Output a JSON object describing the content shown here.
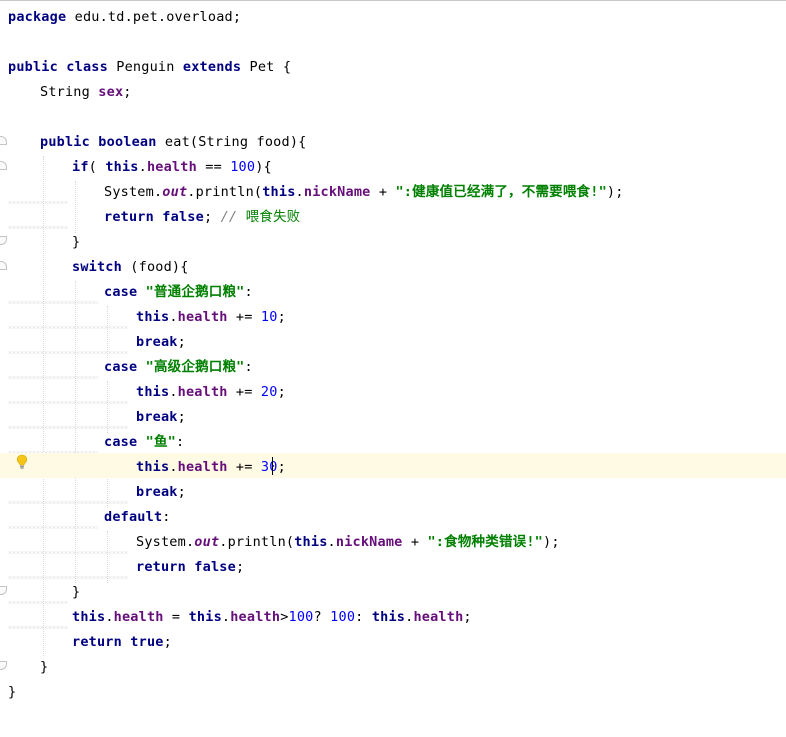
{
  "editor": {
    "language": "java",
    "theme_colors": {
      "keyword": "#000080",
      "field": "#660e7a",
      "number": "#0000ff",
      "string": "#008000",
      "comment": "#808080",
      "caret_line": "#fffae3"
    },
    "lines": {
      "l1": {
        "kw1": "package",
        "t1": " edu.td.pet.overload;"
      },
      "l3": {
        "kw1": "public",
        "s1": " ",
        "kw2": "class",
        "t1": " Penguin ",
        "kw3": "extends",
        "t2": " Pet {"
      },
      "l4": {
        "t1": "String ",
        "f1": "sex",
        "t2": ";"
      },
      "l6": {
        "kw1": "public",
        "s1": " ",
        "kw2": "boolean",
        "t1": " eat(String food){"
      },
      "l7": {
        "kw1": "if",
        "t1": "( ",
        "kw2": "this",
        "t2": ".",
        "f1": "health",
        "t3": " == ",
        "n1": "100",
        "t4": "){"
      },
      "l8": {
        "t1": "System.",
        "sf1": "out",
        "t2": ".println(",
        "kw1": "this",
        "t3": ".",
        "f1": "nickName",
        "t4": " + ",
        "str1": "\":健康值已经满了，不需要喂食!\"",
        "t5": ");"
      },
      "l9": {
        "kw1": "return",
        "s1": " ",
        "kw2": "false",
        "t1": "; ",
        "c1": "// ",
        "c2": "喂食失败"
      },
      "l10": {
        "t1": "}"
      },
      "l11": {
        "kw1": "switch",
        "t1": " (food){"
      },
      "l12": {
        "kw1": "case",
        "s1": " ",
        "str1": "\"普通企鹅口粮\"",
        "t1": ":"
      },
      "l13": {
        "kw1": "this",
        "t1": ".",
        "f1": "health",
        "t2": " += ",
        "n1": "10",
        "t3": ";"
      },
      "l14": {
        "kw1": "break",
        "t1": ";"
      },
      "l15": {
        "kw1": "case",
        "s1": " ",
        "str1": "\"高级企鹅口粮\"",
        "t1": ":"
      },
      "l16": {
        "kw1": "this",
        "t1": ".",
        "f1": "health",
        "t2": " += ",
        "n1": "20",
        "t3": ";"
      },
      "l17": {
        "kw1": "break",
        "t1": ";"
      },
      "l18": {
        "kw1": "case",
        "s1": " ",
        "str1": "\"鱼\"",
        "t1": ":"
      },
      "l19": {
        "kw1": "this",
        "t1": ".",
        "f1": "health",
        "t2": " += ",
        "n1": "30",
        "t3": ";"
      },
      "l20": {
        "kw1": "break",
        "t1": ";"
      },
      "l21": {
        "kw1": "default",
        "t1": ":"
      },
      "l22": {
        "t1": "System.",
        "sf1": "out",
        "t2": ".println(",
        "kw1": "this",
        "t3": ".",
        "f1": "nickName",
        "t4": " + ",
        "str1": "\":食物种类错误!\"",
        "t5": ");"
      },
      "l23": {
        "kw1": "return",
        "s1": " ",
        "kw2": "false",
        "t1": ";"
      },
      "l24": {
        "t1": "}"
      },
      "l25": {
        "kw1": "this",
        "t1": ".",
        "f1": "health",
        "t2": " = ",
        "kw2": "this",
        "t3": ".",
        "f2": "health",
        "t4": ">",
        "n1": "100",
        "t5": "? ",
        "n2": "100",
        "t6": ": ",
        "kw3": "this",
        "t7": ".",
        "f3": "health",
        "t8": ";"
      },
      "l26": {
        "kw1": "return",
        "s1": " ",
        "kw2": "true",
        "t1": ";"
      },
      "l27": {
        "t1": "}"
      },
      "l28": {
        "t1": "}"
      }
    },
    "gutter": {
      "intention_icon": "lightbulb-icon"
    }
  }
}
